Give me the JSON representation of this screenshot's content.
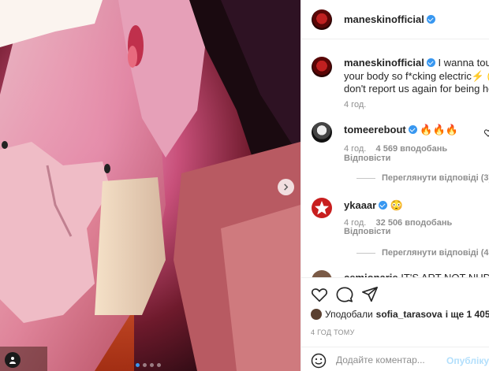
{
  "post": {
    "username": "maneskinofficial",
    "caption_text": "I wanna touch your body so f*cking electric",
    "caption_lines": [
      "I wanna touch",
      "your body so f*cking electric",
      "⚡ (pls",
      "don't report us again for being hot",
      "😊"
    ],
    "caption_time": "4 год.",
    "carousel_dots": 4,
    "carousel_active": 0
  },
  "comments": [
    {
      "username": "tomeerebout",
      "text": "🔥🔥🔥",
      "time": "4 год.",
      "likes": "4 569 вподобань",
      "reply_label": "Відповісти",
      "view_replies": "Переглянути відповіді (3)"
    },
    {
      "username": "ykaaar",
      "text": "😳",
      "time": "4 год.",
      "likes": "32 506 вподобань",
      "reply_label": "Відповісти",
      "view_replies": "Переглянути відповіді (475)"
    },
    {
      "username": "cemionarie",
      "text": "IT'S ART NOT NUDITY"
    }
  ],
  "actions": {
    "liked_by_prefix": "Уподобали",
    "liked_by_user": "sofia_tarasova",
    "liked_by_suffix": "і ще 1 405 979",
    "time_ago": "4 ГОД ТОМУ"
  },
  "add_comment": {
    "placeholder": "Додайте коментар...",
    "post_label": "Опублікувати"
  },
  "icons": {
    "verified": "verified-badge-icon",
    "heart": "heart-icon",
    "comment": "comment-icon",
    "share": "share-icon",
    "emoji": "emoji-icon",
    "next": "chevron-right-icon",
    "tag": "user-tag-icon"
  },
  "colors": {
    "accent": "#3897f0",
    "muted": "#8e8e8e",
    "post_disabled": "#b2dffc"
  }
}
